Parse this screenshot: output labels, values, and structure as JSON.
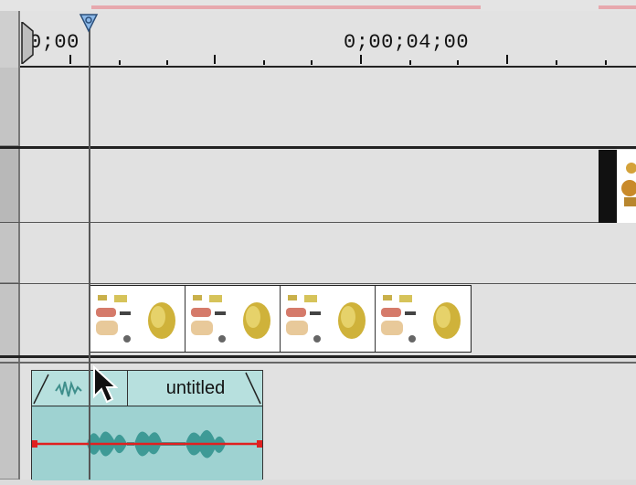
{
  "ruler": {
    "start_timecode": "0;00",
    "label_timecode": "0;00;04;00"
  },
  "audio_clip": {
    "name": "untitled"
  },
  "colors": {
    "background": "#dcdcdc",
    "lane": "#e1e1e1",
    "audio_clip": "#8fc9c8",
    "volume_line": "#e02020",
    "playhead_handle": "#8bb8e8",
    "range_bar": "#e7a8ad"
  },
  "icons": {
    "playhead": "playhead-handle-icon",
    "cursor": "arrow-cursor-icon",
    "in_marker": "in-point-marker-icon"
  }
}
